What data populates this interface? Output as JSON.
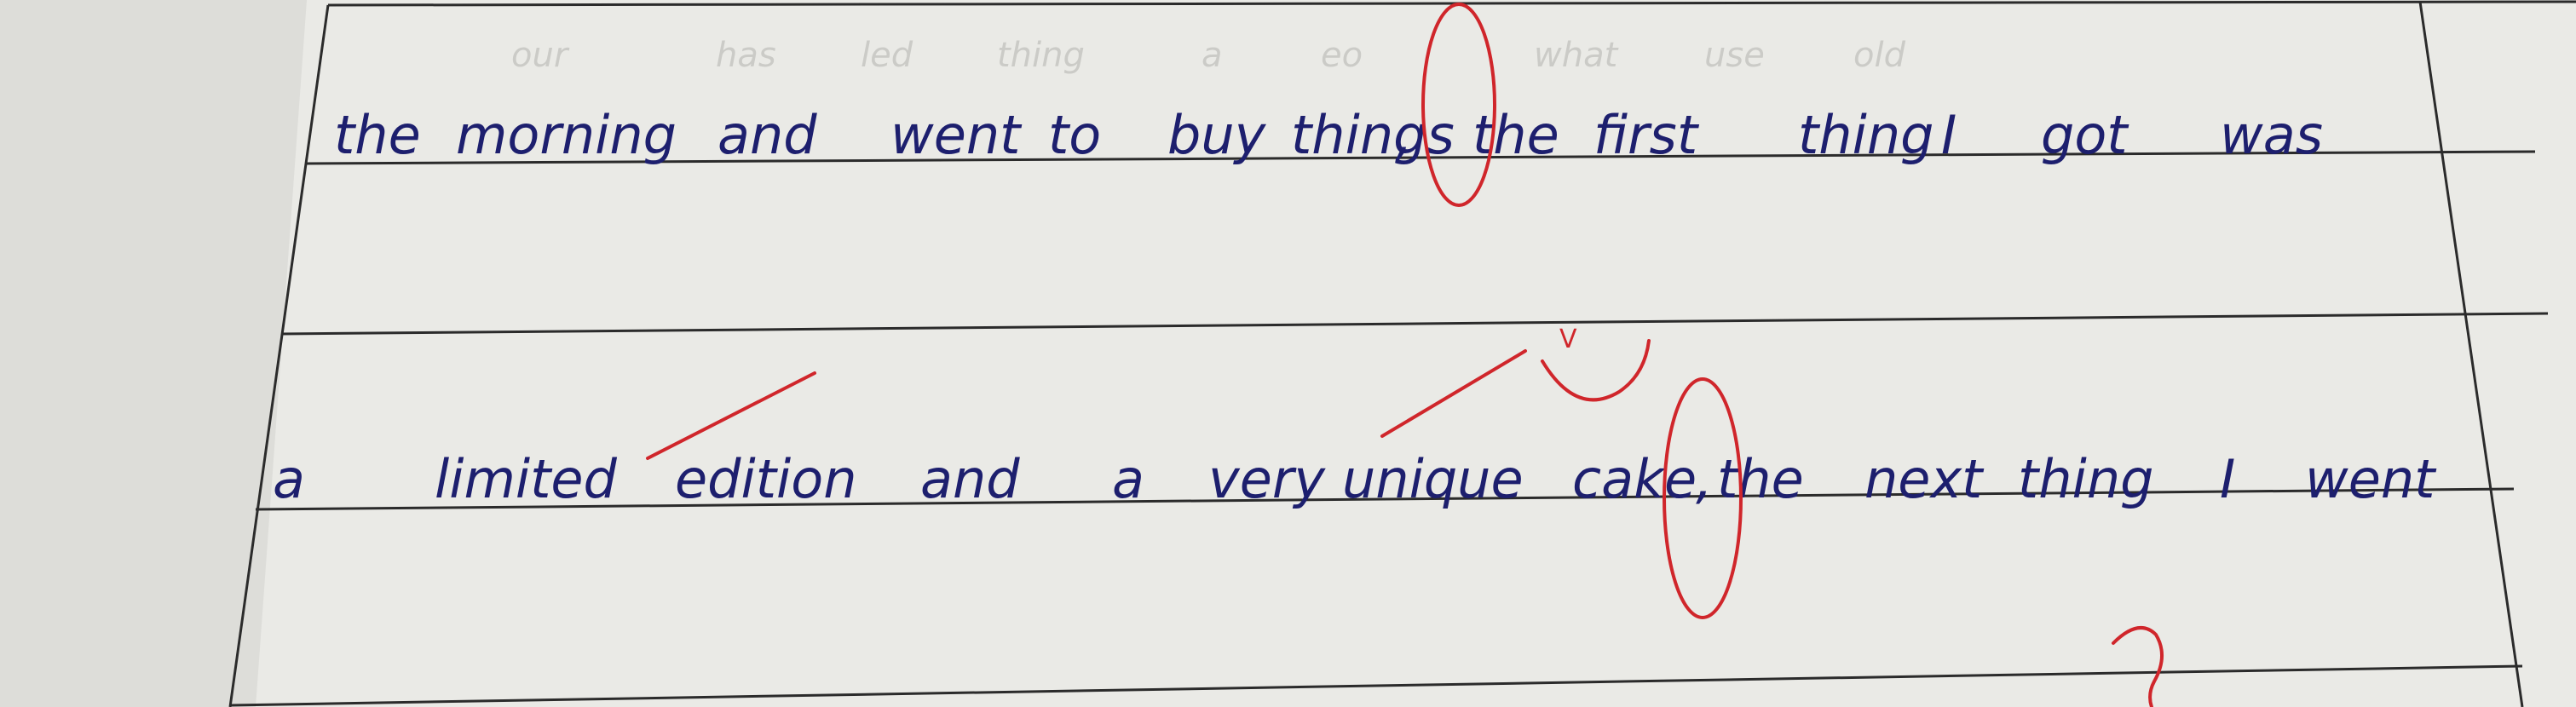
{
  "paper": {
    "bleed_through_text": [
      "our",
      "has",
      "led",
      "thing",
      "a",
      "eo",
      "what",
      "use",
      "old"
    ]
  },
  "lines": [
    {
      "words": [
        "the",
        "morning",
        "and",
        "went",
        "to",
        "buy",
        "things",
        ",",
        "the",
        "first",
        "thing",
        "I",
        "got",
        "was"
      ]
    },
    {
      "words": [
        "a",
        "limited",
        "edition",
        "and",
        "a",
        "very",
        "unique",
        "cake",
        ",",
        "the",
        "next",
        "thing",
        "I",
        "went"
      ]
    }
  ],
  "corrections": {
    "note_mark": "V",
    "marks": [
      "circle-comma-things",
      "strike-edition",
      "strike-very",
      "circle-comma-cake",
      "hook-mark"
    ]
  },
  "colors": {
    "ink": "#1d1f6e",
    "correction": "#d0262b",
    "rule": "#2b2b2b",
    "paper": "#e9e9e5"
  }
}
